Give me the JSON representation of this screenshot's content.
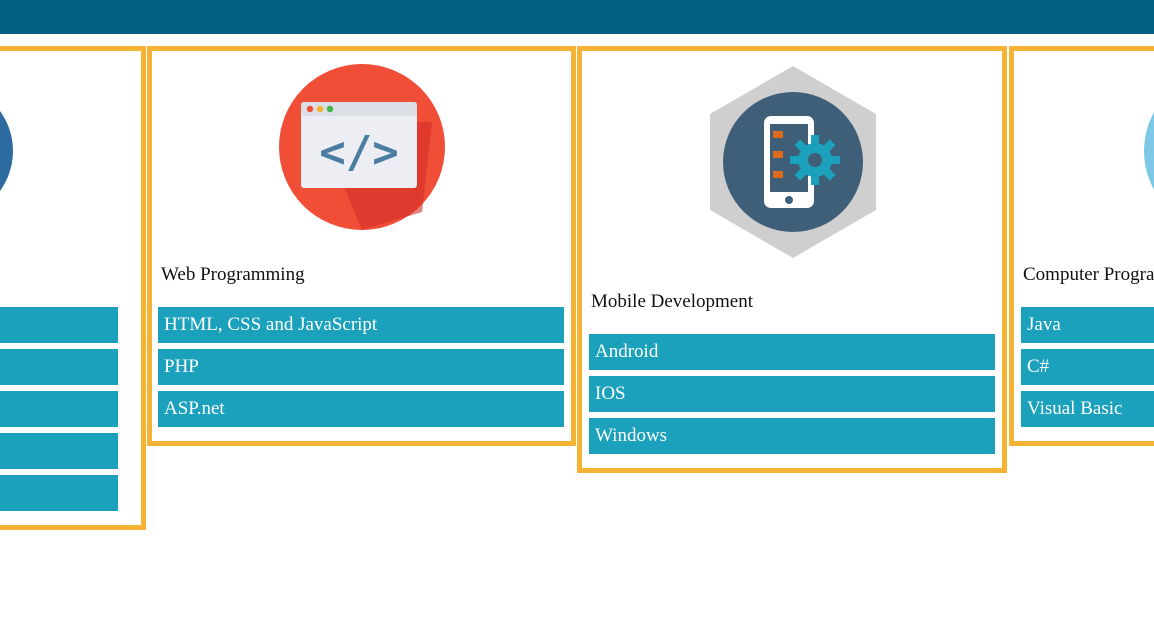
{
  "header": {
    "color": "#005f82"
  },
  "accent_colors": {
    "card_border": "#f5b335",
    "list_item": "#1ba1bc"
  },
  "cards": [
    {
      "title": "",
      "icon": "circle-badge-icon",
      "items": [
        "",
        "",
        "",
        "",
        ""
      ]
    },
    {
      "title": "Web Programming",
      "icon": "code-window-icon",
      "items": [
        "HTML, CSS and JavaScript",
        "PHP",
        "ASP.net"
      ]
    },
    {
      "title": "Mobile Development",
      "icon": "mobile-gear-icon",
      "items": [
        "Android",
        "IOS",
        "Windows"
      ]
    },
    {
      "title": "Computer Programming",
      "icon": "circle-badge-icon",
      "items": [
        "Java",
        "C#",
        "Visual Basic"
      ]
    }
  ]
}
